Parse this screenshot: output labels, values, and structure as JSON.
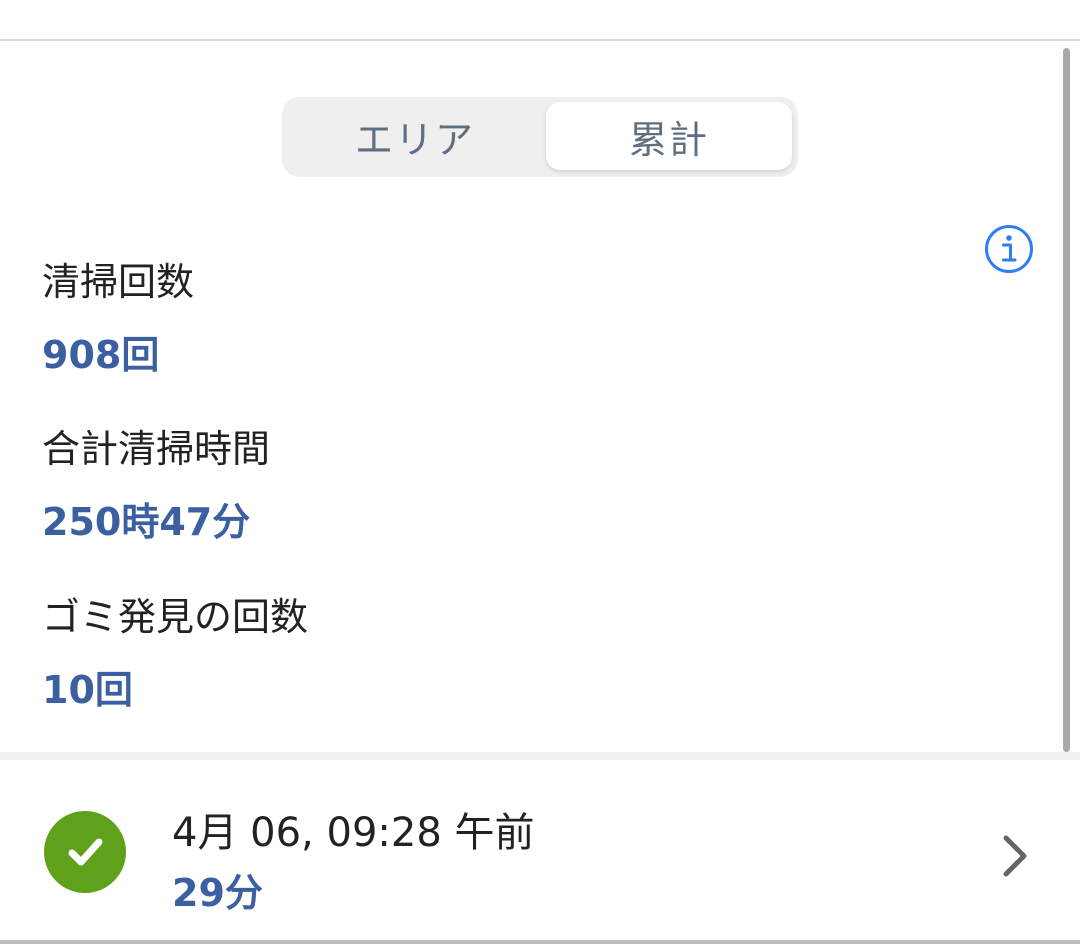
{
  "segmented_control": {
    "tabs": [
      {
        "label": "エリア",
        "selected": false
      },
      {
        "label": "累計",
        "selected": true
      }
    ]
  },
  "stats": [
    {
      "label": "清掃回数",
      "value": "908回"
    },
    {
      "label": "合計清掃時間",
      "value": "250時47分"
    },
    {
      "label": "ゴミ発見の回数",
      "value": "10回"
    }
  ],
  "history": {
    "datetime": "4月 06, 09:28 午前",
    "duration": "29分",
    "status_icon": "check-circle-icon"
  },
  "colors": {
    "accent": "#3b5fa0",
    "info_blue": "#2f7cf6",
    "success_green": "#5fa11a"
  }
}
